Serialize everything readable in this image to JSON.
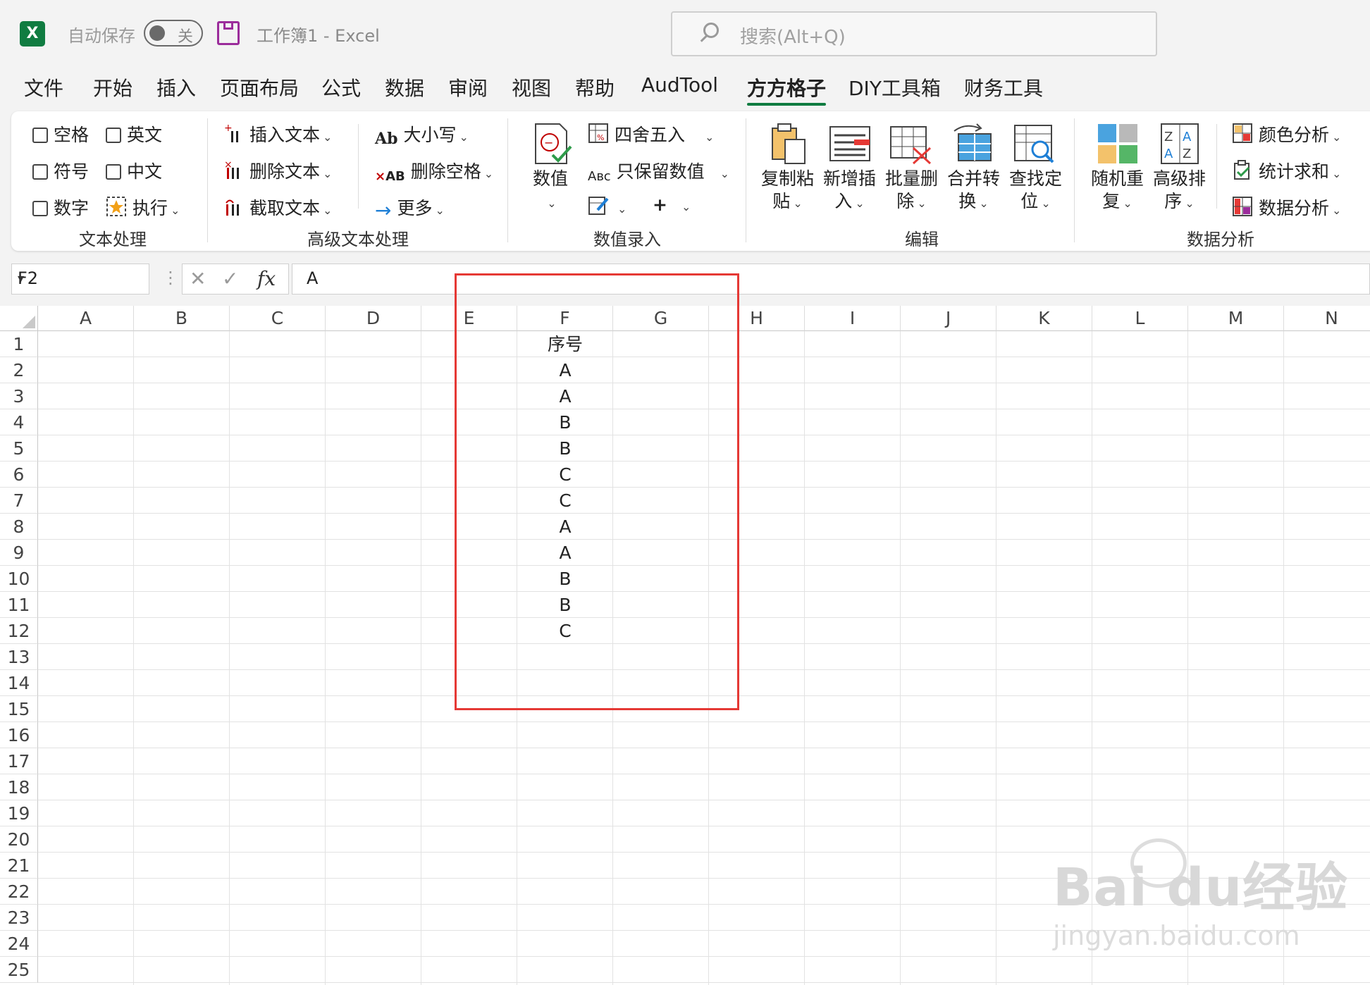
{
  "titlebar": {
    "autosave_label": "自动保存",
    "autosave_state": "关",
    "document_title": "工作簿1  -  Excel",
    "search_placeholder": "搜索(Alt+Q)"
  },
  "menu": [
    "文件",
    "开始",
    "插入",
    "页面布局",
    "公式",
    "数据",
    "审阅",
    "视图",
    "帮助",
    "AudTool",
    "方方格子",
    "DIY工具箱",
    "财务工具"
  ],
  "menu_active": "方方格子",
  "ribbon": {
    "text_processing": {
      "checkboxes": [
        "空格",
        "英文",
        "符号",
        "中文",
        "数字"
      ],
      "execute": "执行",
      "group_label": "文本处理"
    },
    "advanced_text": {
      "insert_text": "插入文本",
      "delete_text": "删除文本",
      "extract_text": "截取文本",
      "case": "大小写",
      "delete_space": "删除空格",
      "more": "更多",
      "group_label": "高级文本处理"
    },
    "numeric_entry": {
      "value_button": "数值",
      "round": "四舍五入",
      "keep_values": "只保留数值",
      "group_label": "数值录入"
    },
    "edit": {
      "copy_paste": [
        "复制粘",
        "贴"
      ],
      "insert_new": [
        "新增插",
        "入"
      ],
      "batch_delete": [
        "批量删",
        "除"
      ],
      "merge_convert": [
        "合并转",
        "换"
      ],
      "find_locate": [
        "查找定",
        "位"
      ],
      "group_label": "编辑"
    },
    "data_analysis": {
      "random_repeat": [
        "随机重",
        "复"
      ],
      "advanced_sort": [
        "高级排",
        "序"
      ],
      "color_analysis": "颜色分析",
      "count_sum": "统计求和",
      "data_analysis": "数据分析",
      "group_label": "数据分析"
    }
  },
  "formula_bar": {
    "name_box": "F2",
    "fx": "fx",
    "content": "A"
  },
  "columns": [
    "A",
    "B",
    "C",
    "D",
    "E",
    "F",
    "G",
    "H",
    "I",
    "J",
    "K",
    "L",
    "M",
    "N"
  ],
  "rows": [
    "1",
    "2",
    "3",
    "4",
    "5",
    "6",
    "7",
    "8",
    "9",
    "10",
    "11",
    "12",
    "13",
    "14",
    "15",
    "16",
    "17",
    "18",
    "19",
    "20",
    "21",
    "22",
    "23",
    "24",
    "25"
  ],
  "column_f_values": [
    "序号",
    "A",
    "A",
    "B",
    "B",
    "C",
    "C",
    "A",
    "A",
    "B",
    "B",
    "C"
  ],
  "watermark": {
    "brand": "Bai  du经验",
    "url": "jingyan.baidu.com"
  },
  "colors": {
    "excel_green": "#107c41",
    "highlight_red": "#e53935"
  }
}
